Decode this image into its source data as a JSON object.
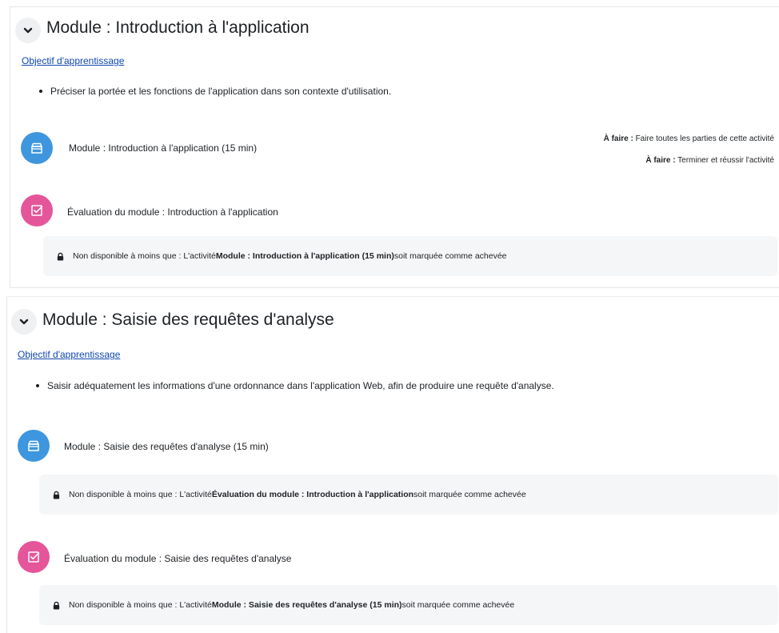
{
  "sections": [
    {
      "title": "Module : Introduction à l'application",
      "objective_link": "Objectif d'apprentissage",
      "objective_bullet": "Préciser la portée et les fonctions de l'application dans son contexte d'utilisation.",
      "activities": [
        {
          "type": "module",
          "icon": "package-icon",
          "name": "Module : Introduction à l'application (15 min)",
          "completion": [
            {
              "label": "À faire :",
              "text": "Faire toutes les parties de cette activité"
            },
            {
              "label": "À faire :",
              "text": "Terminer et réussir l'activité"
            }
          ]
        },
        {
          "type": "quiz",
          "icon": "quiz-check-icon",
          "name": "Évaluation du module : Introduction à l'application",
          "restriction": {
            "prefix": "Non disponible à moins que : L'activité ",
            "activity": "Module : Introduction à l'application (15 min)",
            "suffix": " soit marquée comme achevée"
          }
        }
      ]
    },
    {
      "title": "Module : Saisie des requêtes d'analyse",
      "objective_link": "Objectif d'apprentissage",
      "objective_bullet": "Saisir adéquatement les informations d'une ordonnance dans l'application Web, afin de produire une requête d'analyse.",
      "activities": [
        {
          "type": "module",
          "icon": "package-icon",
          "name": "Module : Saisie des requêtes d'analyse (15 min)",
          "restriction": {
            "prefix": "Non disponible à moins que : L'activité ",
            "activity": "Évaluation du module : Introduction à l'application",
            "suffix": " soit marquée comme achevée"
          }
        },
        {
          "type": "quiz",
          "icon": "quiz-check-icon",
          "name": "Évaluation du module : Saisie des requêtes d'analyse",
          "restriction": {
            "prefix": "Non disponible à moins que : L'activité ",
            "activity": "Module : Saisie des requêtes d'analyse (15 min)",
            "suffix": " soit marquée comme achevée"
          }
        }
      ]
    }
  ],
  "colors": {
    "module_icon": "#3e96de",
    "quiz_icon": "#e5559a",
    "link": "#0f47ad",
    "restriction_bg": "#f5f6f8"
  }
}
